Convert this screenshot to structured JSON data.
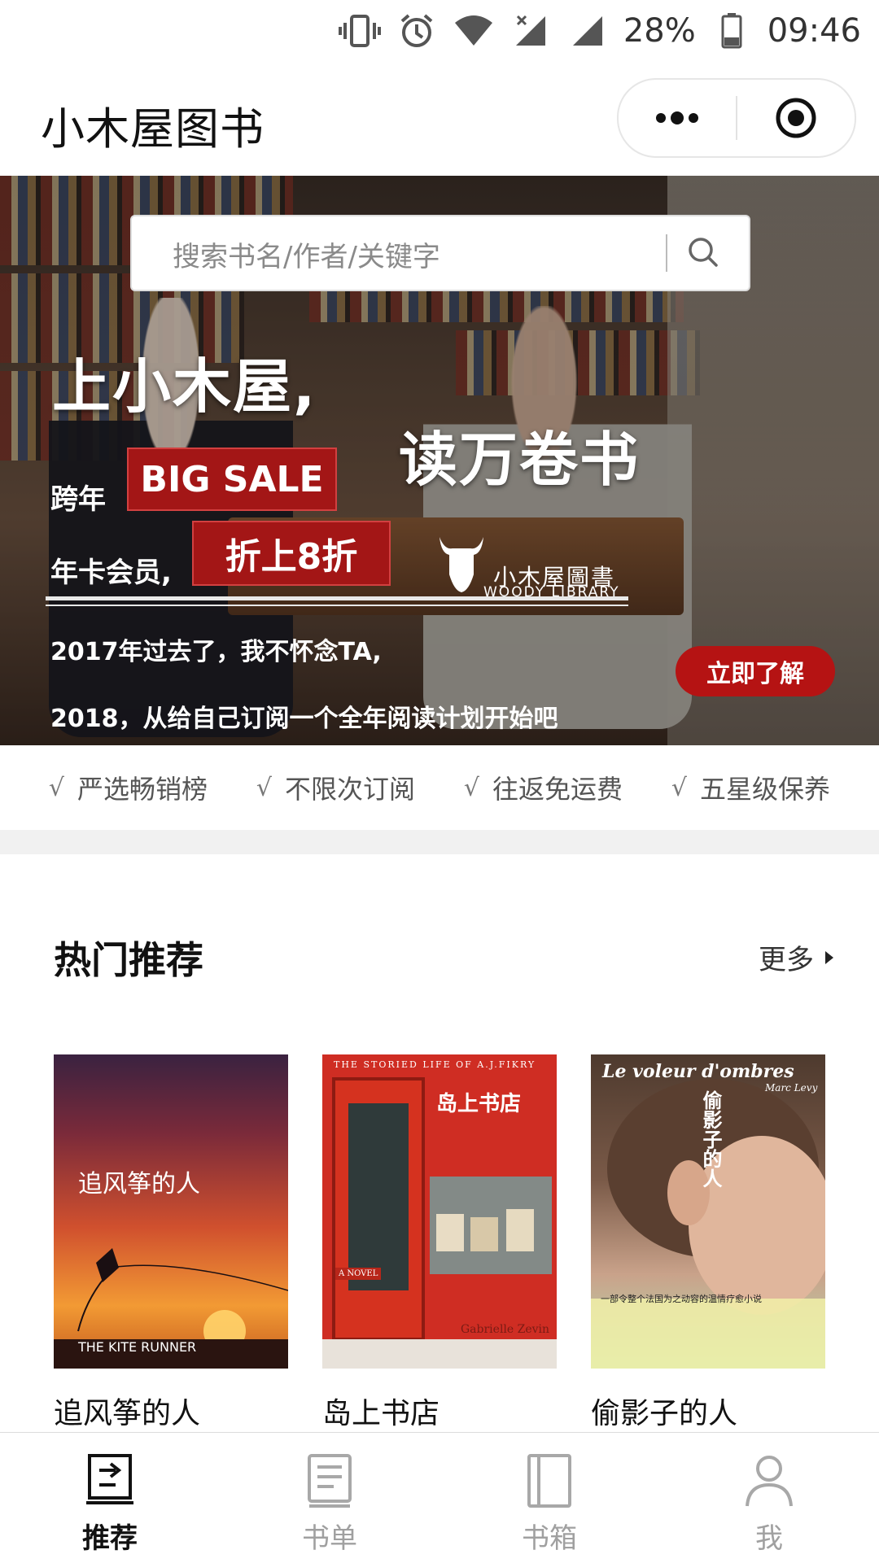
{
  "status_bar": {
    "battery": "28%",
    "time": "09:46"
  },
  "header": {
    "title": "小木屋图书"
  },
  "banner": {
    "search_placeholder": "搜索书名/作者/关键字",
    "slogan_1": "上小木屋,",
    "slogan_2": "读万卷书",
    "kuanian": "跨年",
    "big_sale": "BIG SALE",
    "nianka": "年卡会员,",
    "discount": "折上8折",
    "brand_cn": "小木屋圖書",
    "brand_en": "WOODY LIBRARY",
    "line_1": "2017年过去了，我不怀念TA,",
    "line_2": "2018，从给自己订阅一个全年阅读计划开始吧",
    "cta": "立即了解"
  },
  "features": [
    "严选畅销榜",
    "不限次订阅",
    "往返免运费",
    "五星级保养"
  ],
  "section": {
    "title": "热门推荐",
    "more": "更多"
  },
  "books": [
    {
      "title": "追风筝的人",
      "cover_cn": "追风筝的人",
      "cover_en": "THE KITE RUNNER"
    },
    {
      "title": "岛上书店",
      "cover_cn": "岛上书店",
      "cover_en": "THE STORIED LIFE OF A.J.FIKRY",
      "cover_tag": "A NOVEL",
      "cover_author": "Gabrielle Zevin"
    },
    {
      "title": "偷影子的人",
      "cover_cn": "偷影子的人",
      "cover_en": "Le voleur d'ombres",
      "cover_author": "Marc Levy",
      "cover_tagline": "一部令整个法国为之动容的温情疗愈小说"
    }
  ],
  "tabbar": [
    {
      "label": "推荐",
      "icon": "recommend-icon",
      "active": true
    },
    {
      "label": "书单",
      "icon": "booklist-icon",
      "active": false
    },
    {
      "label": "书箱",
      "icon": "bookbox-icon",
      "active": false
    },
    {
      "label": "我",
      "icon": "profile-icon",
      "active": false
    }
  ],
  "colors": {
    "accent_red": "#a31616",
    "tab_inactive": "#a0a0a0"
  }
}
